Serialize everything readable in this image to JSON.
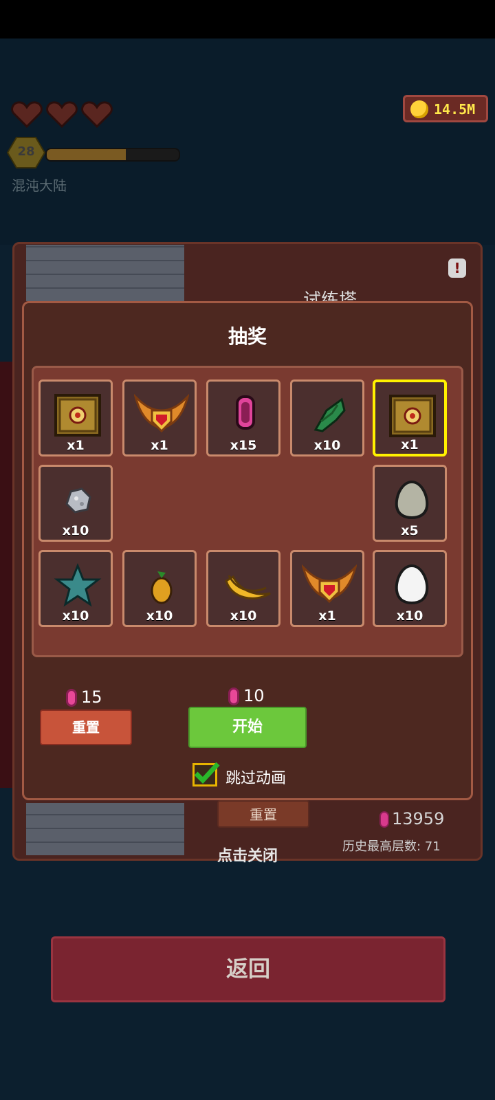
{
  "hud": {
    "hearts": 3,
    "level": "28",
    "xp_progress": 0.6,
    "region": "混沌大陆",
    "coins": "14.5M"
  },
  "tower": {
    "title": "试练塔",
    "reset_label": "重置",
    "gem_total": "13959",
    "best_floor": "历史最高层数: 71",
    "close_hint": "点击关闭"
  },
  "lottery": {
    "title": "抽奖",
    "slots": [
      {
        "qty": "x1",
        "item": "treasure-chest-icon",
        "selected": false
      },
      {
        "qty": "x1",
        "item": "winged-emblem-icon",
        "selected": false
      },
      {
        "qty": "x15",
        "item": "pink-gem-icon",
        "selected": false
      },
      {
        "qty": "x10",
        "item": "green-leaf-icon",
        "selected": false
      },
      {
        "qty": "x1",
        "item": "treasure-chest-icon",
        "selected": true
      },
      {
        "qty": "x10",
        "item": "grey-ore-icon",
        "selected": false
      },
      {
        "qty": "x5",
        "item": "grey-egg-icon",
        "selected": false
      },
      {
        "qty": "x10",
        "item": "teal-star-icon",
        "selected": false
      },
      {
        "qty": "x10",
        "item": "orange-fruit-icon",
        "selected": false
      },
      {
        "qty": "x10",
        "item": "banana-icon",
        "selected": false
      },
      {
        "qty": "x1",
        "item": "winged-emblem-icon",
        "selected": false
      },
      {
        "qty": "x10",
        "item": "white-egg-icon",
        "selected": false
      }
    ],
    "reset_cost": "15",
    "reset_label": "重置",
    "start_cost": "10",
    "start_label": "开始",
    "skip_label": "跳过动画",
    "skip_checked": true
  },
  "back_label": "返回",
  "colors": {
    "background": "#0c1f2e",
    "dialog": "#4d2820",
    "slot_border": "#c98a6c",
    "selected_border": "#fff200",
    "start_green": "#6cc83c",
    "reset_orange": "#c8543a"
  }
}
